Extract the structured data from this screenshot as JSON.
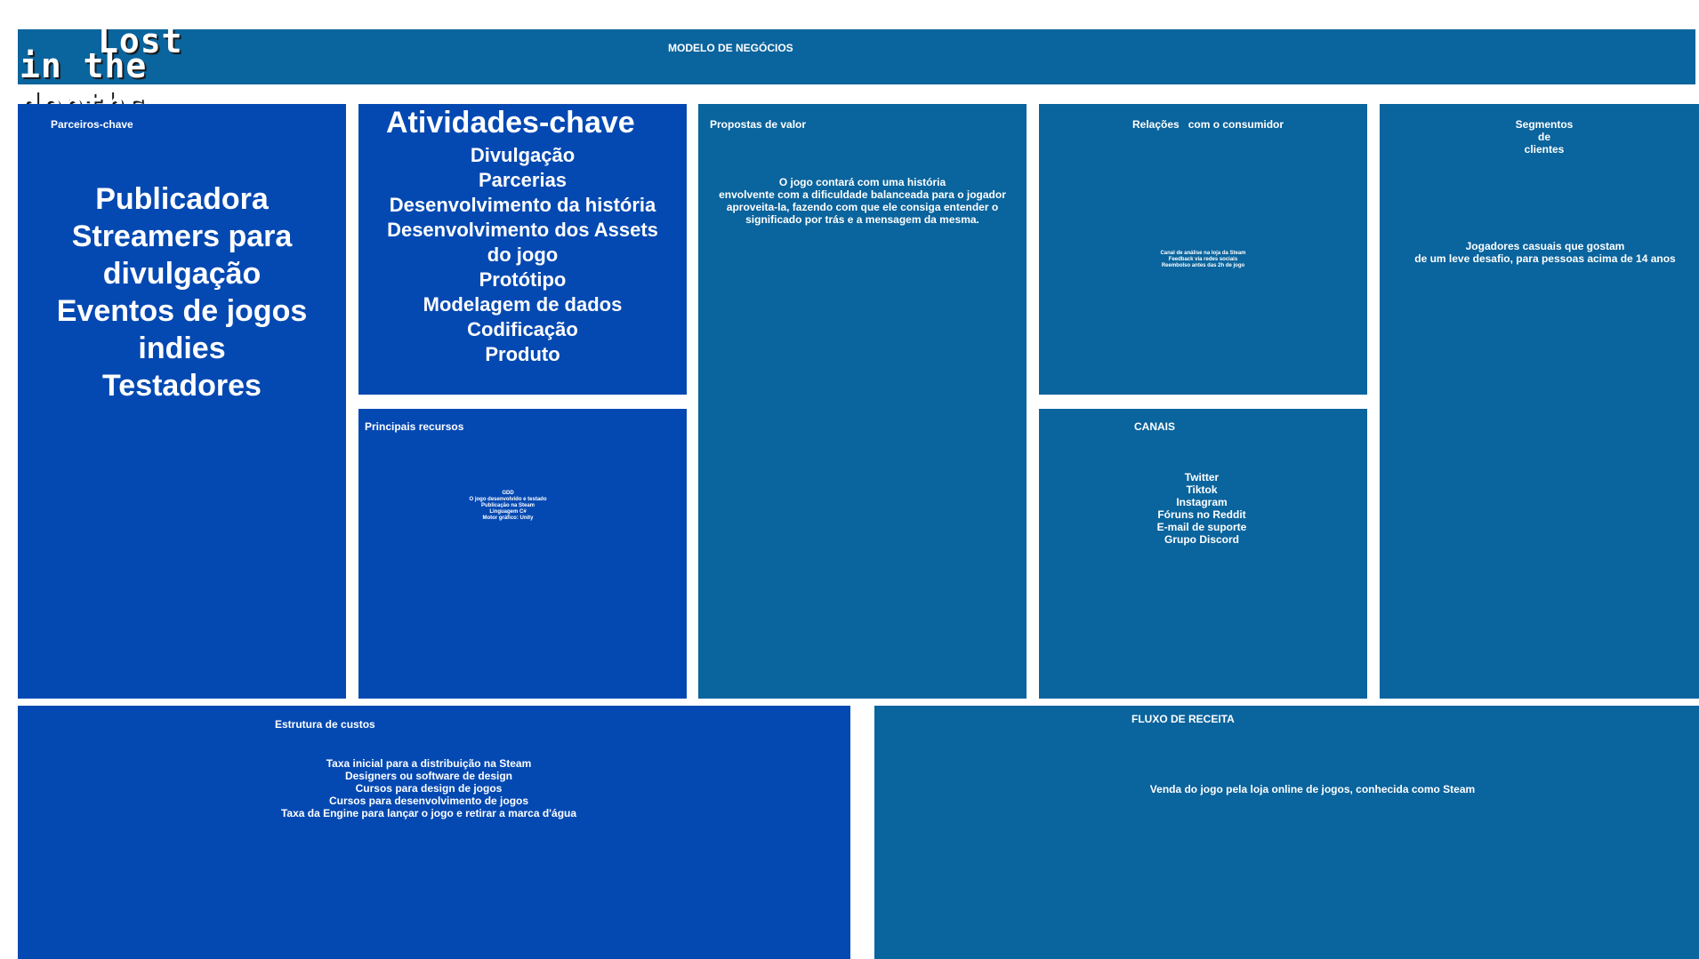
{
  "header": {
    "title": "MODELO DE NEGÓCIOS",
    "logo_line1": "Lost",
    "logo_line2": "in the depths"
  },
  "partners": {
    "title": "Parceiros-chave",
    "lines": [
      "Publicadora",
      "Streamers para",
      "divulgação",
      "Eventos de jogos",
      "indies",
      "Testadores"
    ]
  },
  "activities": {
    "title": "Atividades-chave",
    "lines": [
      "Divulgação",
      "Parcerias",
      "Desenvolvimento da história",
      "Desenvolvimento dos Assets",
      "do jogo",
      "Protótipo",
      "Modelagem de dados",
      "Codificação",
      "Produto"
    ]
  },
  "resources": {
    "title": "Principais recursos",
    "lines": [
      "GDD",
      "O jogo desenvolvido e testado",
      "Publicação na Steam",
      "Linguagem C#",
      "Motor gráfico: Unity"
    ]
  },
  "value": {
    "title": "Propostas de valor",
    "lines": [
      "O jogo contará com uma história",
      "envolvente com a dificuldade balanceada para o jogador",
      "aproveita-la, fazendo com que ele consiga entender o",
      "significado por trás e a mensagem da mesma."
    ]
  },
  "relations": {
    "title": "Relações   com o consumidor",
    "lines": [
      "Canal de análise na loja da Steam",
      "Feedback via redes sociais",
      "Reembolso antes das 2h de jogo"
    ]
  },
  "channels": {
    "title": "CANAIS",
    "lines": [
      "Twitter",
      "Tiktok",
      "Instagram",
      "Fóruns no Reddit",
      "E-mail de suporte",
      "Grupo Discord"
    ]
  },
  "segments": {
    "title_lines": [
      "Segmentos",
      "de",
      "clientes"
    ],
    "lines": [
      "Jogadores casuais que gostam",
      "de um leve desafio, para pessoas acima de 14 anos"
    ]
  },
  "costs": {
    "title": "Estrutura de custos",
    "lines": [
      "Taxa inicial para a distribuição na Steam",
      "Designers ou software de design",
      "Cursos para design de jogos",
      "Cursos para desenvolvimento de jogos",
      "Taxa da Engine para lançar o jogo e retirar a marca d'água"
    ]
  },
  "revenue": {
    "title": "FLUXO DE RECEITA",
    "lines": [
      "Venda do jogo pela loja online de jogos, conhecida como Steam"
    ]
  }
}
